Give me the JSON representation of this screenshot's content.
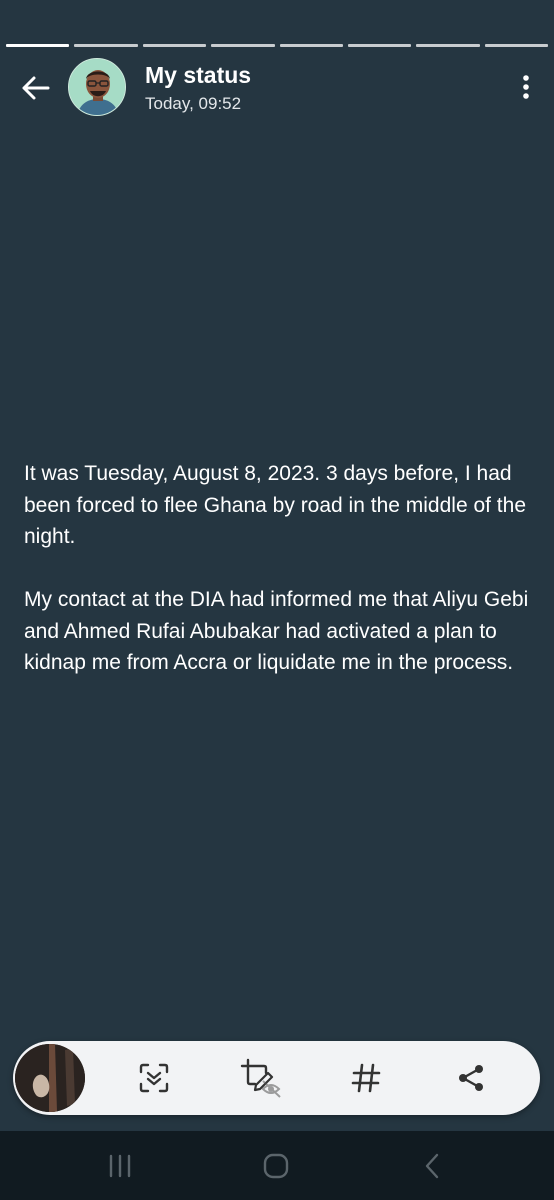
{
  "progress": {
    "segments": 8,
    "current_index": 0
  },
  "header": {
    "title": "My status",
    "timestamp": "Today, 09:52"
  },
  "status": {
    "paragraphs": [
      "It was Tuesday, August 8, 2023. 3 days before, I had been forced to flee Ghana by road in the middle of the night.",
      "My contact at the DIA had informed me that Aliyu Gebi and Ahmed Rufai Abubakar had activated a plan to kidnap me from Accra or liquidate me in the process."
    ],
    "background_color": "#253641"
  },
  "action_bar": {
    "tools": [
      {
        "name": "scan-text-icon"
      },
      {
        "name": "crop-edit-hidden-icon"
      },
      {
        "name": "hashtag-icon"
      },
      {
        "name": "share-icon"
      }
    ]
  },
  "system_nav": {
    "buttons": [
      {
        "name": "recent-apps-icon"
      },
      {
        "name": "home-icon"
      },
      {
        "name": "back-nav-icon"
      }
    ]
  }
}
